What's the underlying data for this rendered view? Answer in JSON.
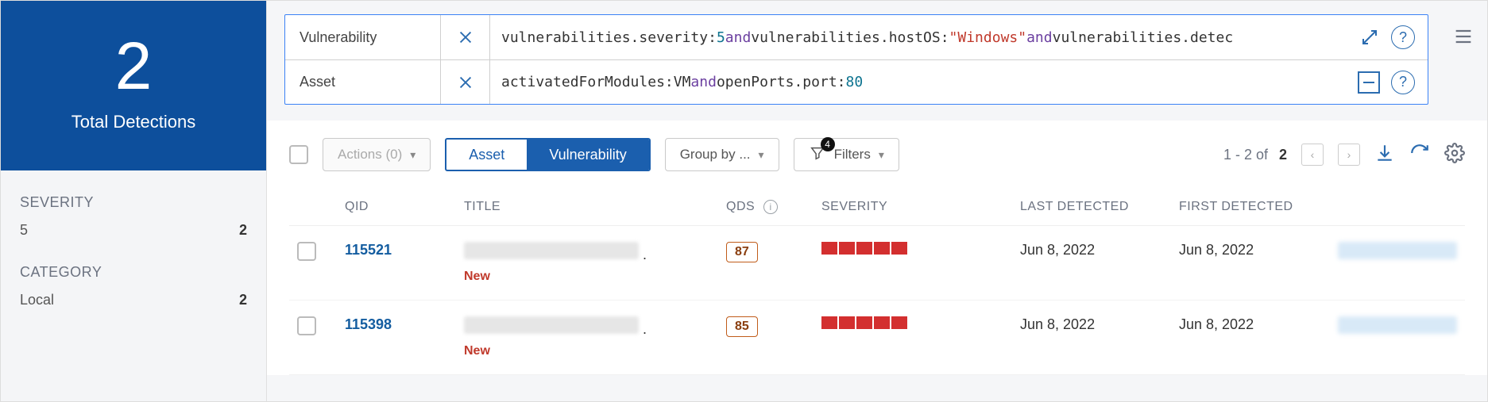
{
  "sidebar": {
    "hero_count": "2",
    "hero_label": "Total Detections",
    "facets": [
      {
        "title": "SEVERITY",
        "rows": [
          {
            "label": "5",
            "count": "2"
          }
        ]
      },
      {
        "title": "CATEGORY",
        "rows": [
          {
            "label": "Local",
            "count": "2"
          }
        ]
      }
    ]
  },
  "query": {
    "rows": [
      {
        "label": "Vulnerability",
        "tokens": [
          {
            "t": "plain",
            "v": "vulnerabilities.severity:"
          },
          {
            "t": "num",
            "v": "5"
          },
          {
            "t": "plain",
            "v": " "
          },
          {
            "t": "kw",
            "v": "and"
          },
          {
            "t": "plain",
            "v": " vulnerabilities.hostOS:"
          },
          {
            "t": "str",
            "v": "\"Windows\""
          },
          {
            "t": "plain",
            "v": " "
          },
          {
            "t": "kw",
            "v": "and"
          },
          {
            "t": "plain",
            "v": " vulnerabilities.detec"
          }
        ],
        "actions": [
          "expand",
          "help"
        ]
      },
      {
        "label": "Asset",
        "tokens": [
          {
            "t": "plain",
            "v": "activatedForModules:VM "
          },
          {
            "t": "kw",
            "v": "and"
          },
          {
            "t": "plain",
            "v": " openPorts.port:"
          },
          {
            "t": "num",
            "v": "80"
          }
        ],
        "actions": [
          "collapse",
          "help"
        ]
      }
    ]
  },
  "toolbar": {
    "actions_label": "Actions (0)",
    "seg_asset": "Asset",
    "seg_vuln": "Vulnerability",
    "group_by": "Group by ...",
    "filters_label": "Filters",
    "filters_count": "4",
    "range_prefix": "1 - 2 of ",
    "range_total": "2"
  },
  "table": {
    "headers": {
      "qid": "QID",
      "title": "TITLE",
      "qds": "QDS",
      "severity": "SEVERITY",
      "last": "LAST DETECTED",
      "first": "FIRST DETECTED"
    },
    "rows": [
      {
        "qid": "115521",
        "new": "New",
        "qds": "87",
        "severity": 5,
        "last": "Jun 8, 2022",
        "first": "Jun 8, 2022"
      },
      {
        "qid": "115398",
        "new": "New",
        "qds": "85",
        "severity": 5,
        "last": "Jun 8, 2022",
        "first": "Jun 8, 2022"
      }
    ]
  }
}
